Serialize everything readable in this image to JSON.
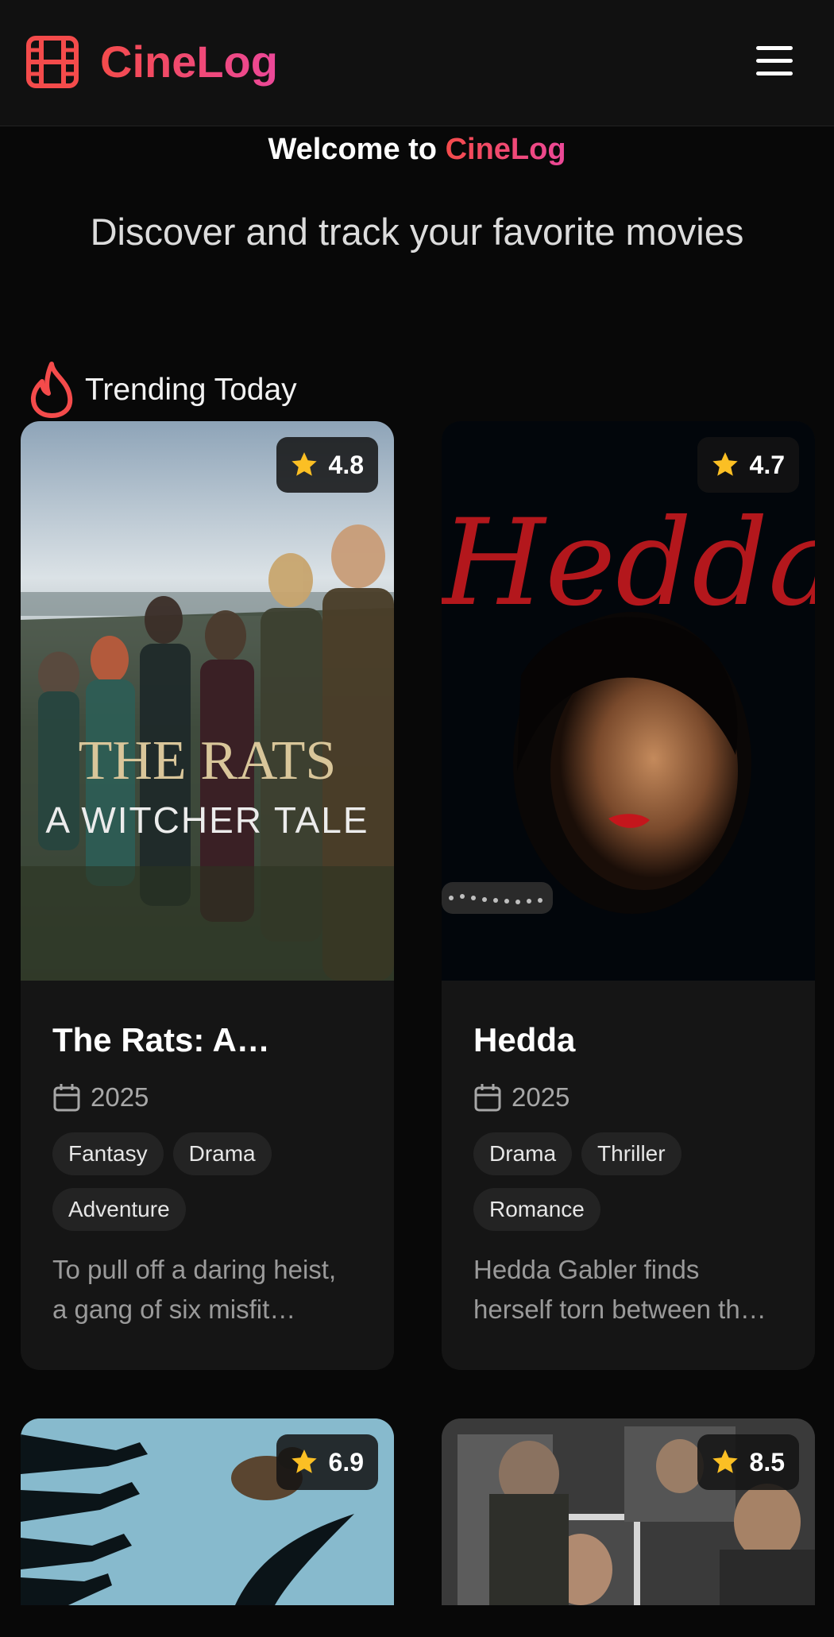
{
  "header": {
    "brand": "CineLog",
    "logo_icon": "film-icon",
    "menu_icon": "menu-icon"
  },
  "hero": {
    "welcome_prefix": "Welcome to ",
    "welcome_brand": "CineLog",
    "subtitle": "Discover and track your favorite movies"
  },
  "trending": {
    "icon": "flame-icon",
    "title": "Trending Today",
    "movies": [
      {
        "title": "The Rats: A…",
        "poster_text_line1": "THE RATS",
        "poster_text_line2": "A WITCHER TALE",
        "rating": "4.8",
        "year": "2025",
        "genres": [
          "Fantasy",
          "Drama",
          "Adventure"
        ],
        "desc_line1": "To pull off a daring heist,",
        "desc_line2": "a gang of six misfit…"
      },
      {
        "title": "Hedda",
        "poster_text_line1": "Hedda",
        "rating": "4.7",
        "year": "2025",
        "genres": [
          "Drama",
          "Thriller",
          "Romance"
        ],
        "desc_line1": "Hedda Gabler finds",
        "desc_line2": "herself torn between th…"
      },
      {
        "rating": "6.9"
      },
      {
        "rating": "8.5"
      }
    ]
  },
  "colors": {
    "accent_red": "#f44b4b",
    "accent_pink": "#ec4899",
    "star": "#fbbf24",
    "background": "#080808",
    "card": "#151515"
  }
}
